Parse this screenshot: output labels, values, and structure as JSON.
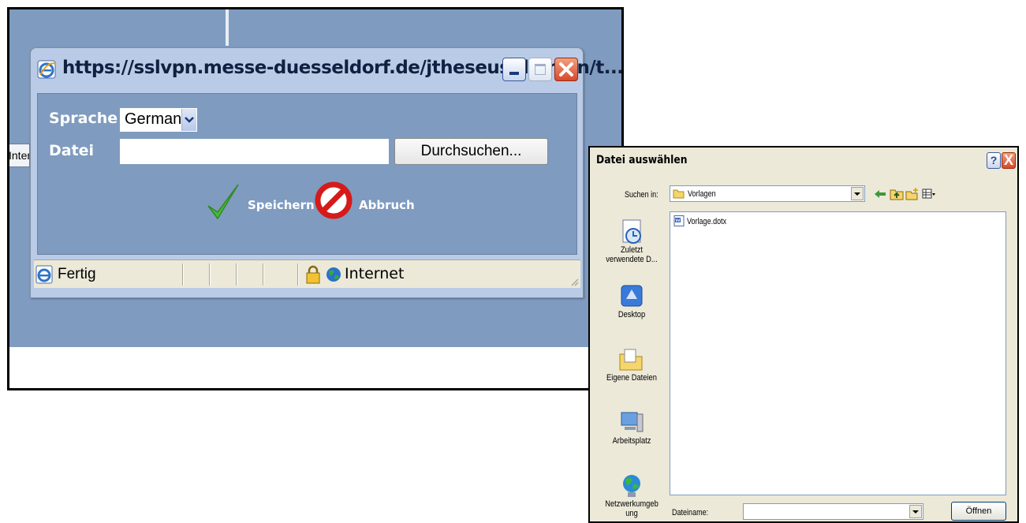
{
  "background": {
    "partial_button_label": "Intern"
  },
  "popup": {
    "title": "https://sslvpn.messe-duesseldorf.de/jtheseus/domain/t...",
    "form": {
      "language_label": "Sprache",
      "language_value": "German",
      "file_label": "Datei",
      "file_value": "",
      "browse_label": "Durchsuchen...",
      "save_label": "Speichern",
      "cancel_label": "Abbruch"
    },
    "status": {
      "text": "Fertig",
      "zone": "Internet"
    }
  },
  "dialog": {
    "title": "Datei auswählen",
    "help_label": "?",
    "close_label": "X",
    "lookin_label": "Suchen in:",
    "lookin_value": "Vorlagen",
    "places": [
      {
        "label": "Zuletzt verwendete D...",
        "icon": "recent-documents-icon"
      },
      {
        "label": "Desktop",
        "icon": "desktop-icon"
      },
      {
        "label": "Eigene Dateien",
        "icon": "my-documents-icon"
      },
      {
        "label": "Arbeitsplatz",
        "icon": "my-computer-icon"
      },
      {
        "label": "Netzwerkumgeb ung",
        "icon": "network-places-icon"
      }
    ],
    "files": [
      {
        "name": "Vorlage.dotx",
        "icon": "word-document-icon"
      }
    ],
    "filename_label": "Dateiname:",
    "filename_value": "",
    "open_label": "Öffnen"
  },
  "colors": {
    "page_blue": "#7f9bbf",
    "xp_titlebar": "#b9cbe6",
    "dialog_face": "#ece9d8"
  }
}
